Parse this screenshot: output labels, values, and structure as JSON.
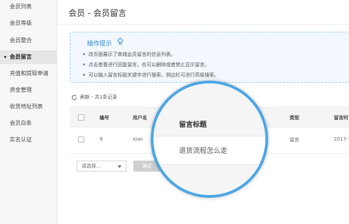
{
  "sidebar": {
    "items": [
      {
        "label": "会员列表"
      },
      {
        "label": "会员等级"
      },
      {
        "label": "会员整合"
      },
      {
        "label": "会员留言"
      },
      {
        "label": "充值和提现申请"
      },
      {
        "label": "资金管理"
      },
      {
        "label": "收货地址列表"
      },
      {
        "label": "会员白条"
      },
      {
        "label": "实名认证"
      }
    ],
    "active_index": 3
  },
  "header": {
    "title": "会员 - 会员留言"
  },
  "tips": {
    "title": "操作提示",
    "lines": [
      "改页面展示了商城会员留言的信息列表。",
      "点击查看进行回复留言，也可以删除或者禁止显示留言。",
      "可以输入留言标题关键字进行搜索，侧边栏可进行高级搜索。"
    ]
  },
  "toolbar": {
    "refresh_text": "刷新 - 共1条记录"
  },
  "table": {
    "headers": {
      "id": "编号",
      "user": "用户名",
      "type": "类型",
      "time": "留言时"
    },
    "rows": [
      {
        "id": "9",
        "user": "xiao",
        "type": "留言",
        "time": "2017-"
      }
    ]
  },
  "bulk": {
    "select_placeholder": "请选择...",
    "confirm_label": "确定"
  },
  "magnifier": {
    "header": "留言标题",
    "value": "退货流程怎么走"
  },
  "colors": {
    "accent": "#4aa6e6",
    "tips_bg": "#f2f8fd",
    "tips_title": "#2a87cf"
  }
}
